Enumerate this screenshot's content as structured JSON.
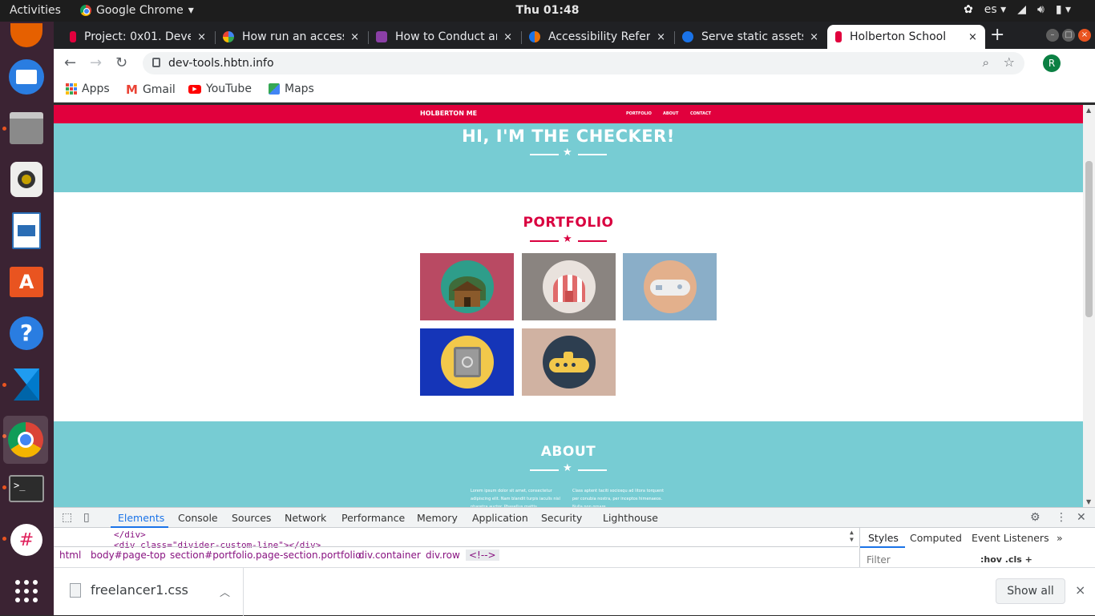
{
  "system": {
    "activities": "Activities",
    "app_name": "Google Chrome",
    "clock": "Thu 01:48",
    "language": "es"
  },
  "tabs": [
    {
      "title": "Project: 0x01. Deve",
      "close": "×",
      "favicon_color": "#e1003d"
    },
    {
      "title": "How run an access",
      "close": "×",
      "favicon_color": "#4285f4"
    },
    {
      "title": "How to Conduct an",
      "close": "×",
      "favicon_color": "#8b3fa6"
    },
    {
      "title": "Accessibility Refer",
      "close": "×",
      "favicon_color": "#e8710a"
    },
    {
      "title": "Serve static assets",
      "close": "×",
      "favicon_color": "#1a73e8"
    },
    {
      "title": "Holberton School",
      "close": "×",
      "favicon_color": "#e1003d"
    }
  ],
  "new_tab": "+",
  "toolbar": {
    "url": "dev-tools.hbtn.info",
    "avatar_letter": "R"
  },
  "bookmarks": [
    {
      "label": "Apps"
    },
    {
      "label": "Gmail"
    },
    {
      "label": "YouTube"
    },
    {
      "label": "Maps"
    }
  ],
  "site": {
    "brand": "HOLBERTON ME",
    "nav_links": [
      "PORTFOLIO",
      "ABOUT",
      "CONTACT"
    ],
    "hero_title": "HI, I'M THE CHECKER!",
    "portfolio_title": "PORTFOLIO",
    "about_title": "ABOUT",
    "about_col1": "Lorem ipsum dolor sit amet, consectetur adipiscing elit. Nam blandit turpis iaculis nisl pharetra auctor. Phasellus mattis",
    "about_col2": "Class aptent taciti sociosqu ad litora torquent per conubia nostra, per inceptos himenaeos. Nulla non ornare",
    "accent_color": "#e1003d",
    "teal_color": "#77ccd3",
    "portfolio_items": [
      {
        "name": "cabin",
        "bg": "#b94a63"
      },
      {
        "name": "circus-tent",
        "bg": "#8a8480"
      },
      {
        "name": "game-controller",
        "bg": "#8aaec8"
      },
      {
        "name": "safe",
        "bg": "#1535b8"
      },
      {
        "name": "submarine",
        "bg": "#d0b2a2"
      }
    ]
  },
  "devtools": {
    "tabs": [
      "Elements",
      "Console",
      "Sources",
      "Network",
      "Performance",
      "Memory",
      "Application",
      "Security",
      "Lighthouse"
    ],
    "code_line1": "</div>",
    "code_line2": "<div class=\"divider-custom-line\"></div>",
    "breadcrumbs": [
      "html",
      "body#page-top",
      "section#portfolio.page-section.portfolio",
      "div.container",
      "div.row",
      "<!--> "
    ],
    "side_tabs": [
      "Styles",
      "Computed",
      "Event Listeners"
    ],
    "side_more": "»",
    "filter_placeholder": "Filter",
    "filter_tools": ":hov  .cls  +"
  },
  "downloads": {
    "file": "freelancer1.css",
    "show_all": "Show all",
    "close": "×"
  }
}
